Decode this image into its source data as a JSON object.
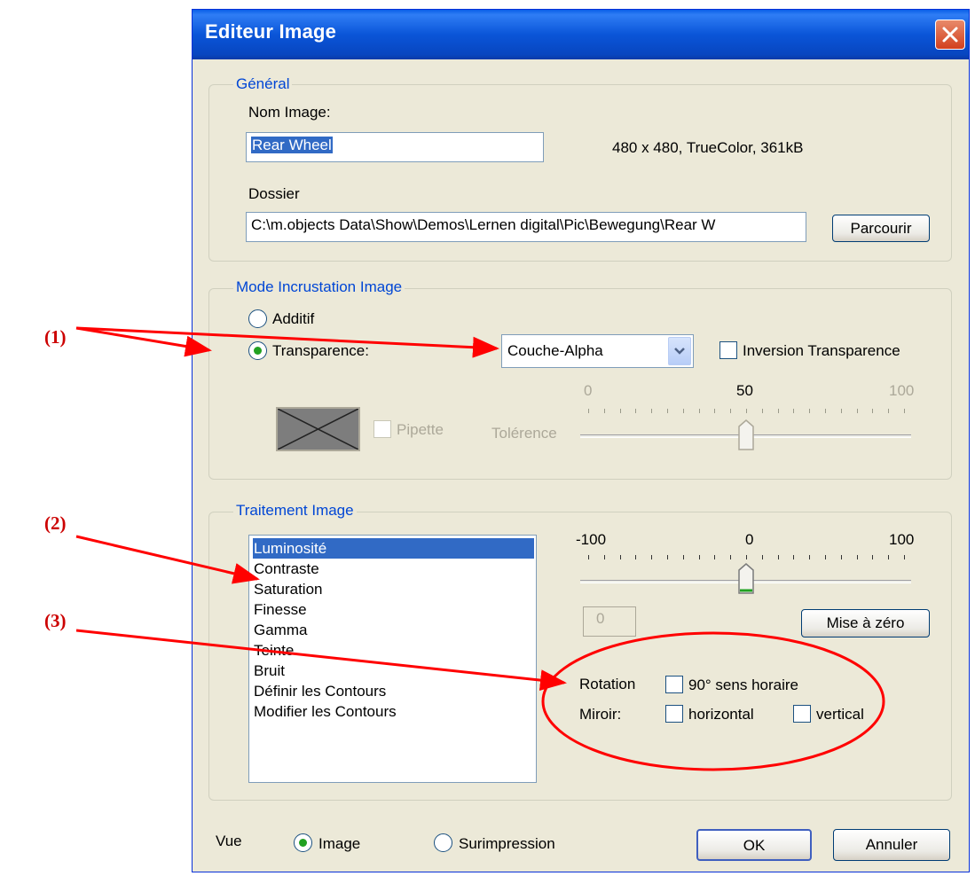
{
  "window": {
    "title": "Editeur Image"
  },
  "general": {
    "legend": "Général",
    "name_label": "Nom Image:",
    "name_value": "Rear Wheel",
    "info": "480 x 480, TrueColor, 361kB",
    "folder_label": "Dossier",
    "folder_value": "C:\\m.objects Data\\Show\\Demos\\Lernen digital\\Pic\\Bewegung\\Rear W",
    "browse_button": "Parcourir"
  },
  "overlay": {
    "legend": "Mode Incrustation Image",
    "additive_label": "Additif",
    "additive_selected": false,
    "transparency_label": "Transparence:",
    "transparency_selected": true,
    "mode_value": "Couche-Alpha",
    "invert_label": "Inversion Transparence",
    "invert_checked": false,
    "pipette_label": "Pipette",
    "tolerance_label": "Tolérence",
    "slider_min": "0",
    "slider_mid": "50",
    "slider_max": "100",
    "tolerance_value": 50
  },
  "processing": {
    "legend": "Traitement Image",
    "items": [
      "Luminosité",
      "Contraste",
      "Saturation",
      "Finesse",
      "Gamma",
      "Teinte",
      "Bruit",
      "Définir les Contours",
      "Modifier les Contours"
    ],
    "selected_index": 0,
    "slider_min": "-100",
    "slider_mid": "0",
    "slider_max": "100",
    "slider_value": 0,
    "value_box": "0",
    "reset_button": "Mise à zéro",
    "rotation_label": "Rotation",
    "rotation_check_label": "90° sens horaire",
    "mirror_label": "Miroir:",
    "mirror_horizontal": "horizontal",
    "mirror_vertical": "vertical"
  },
  "view": {
    "label": "Vue",
    "image_label": "Image",
    "image_selected": true,
    "overprint_label": "Surimpression"
  },
  "buttons": {
    "ok": "OK",
    "cancel": "Annuler"
  },
  "annotations": {
    "a1": "(1)",
    "a2": "(2)",
    "a3": "(3)"
  },
  "colors": {
    "annotation": "#ff0000",
    "titlebar": "#0a55d8",
    "selection": "#316ac5",
    "legend": "#0046d5"
  }
}
